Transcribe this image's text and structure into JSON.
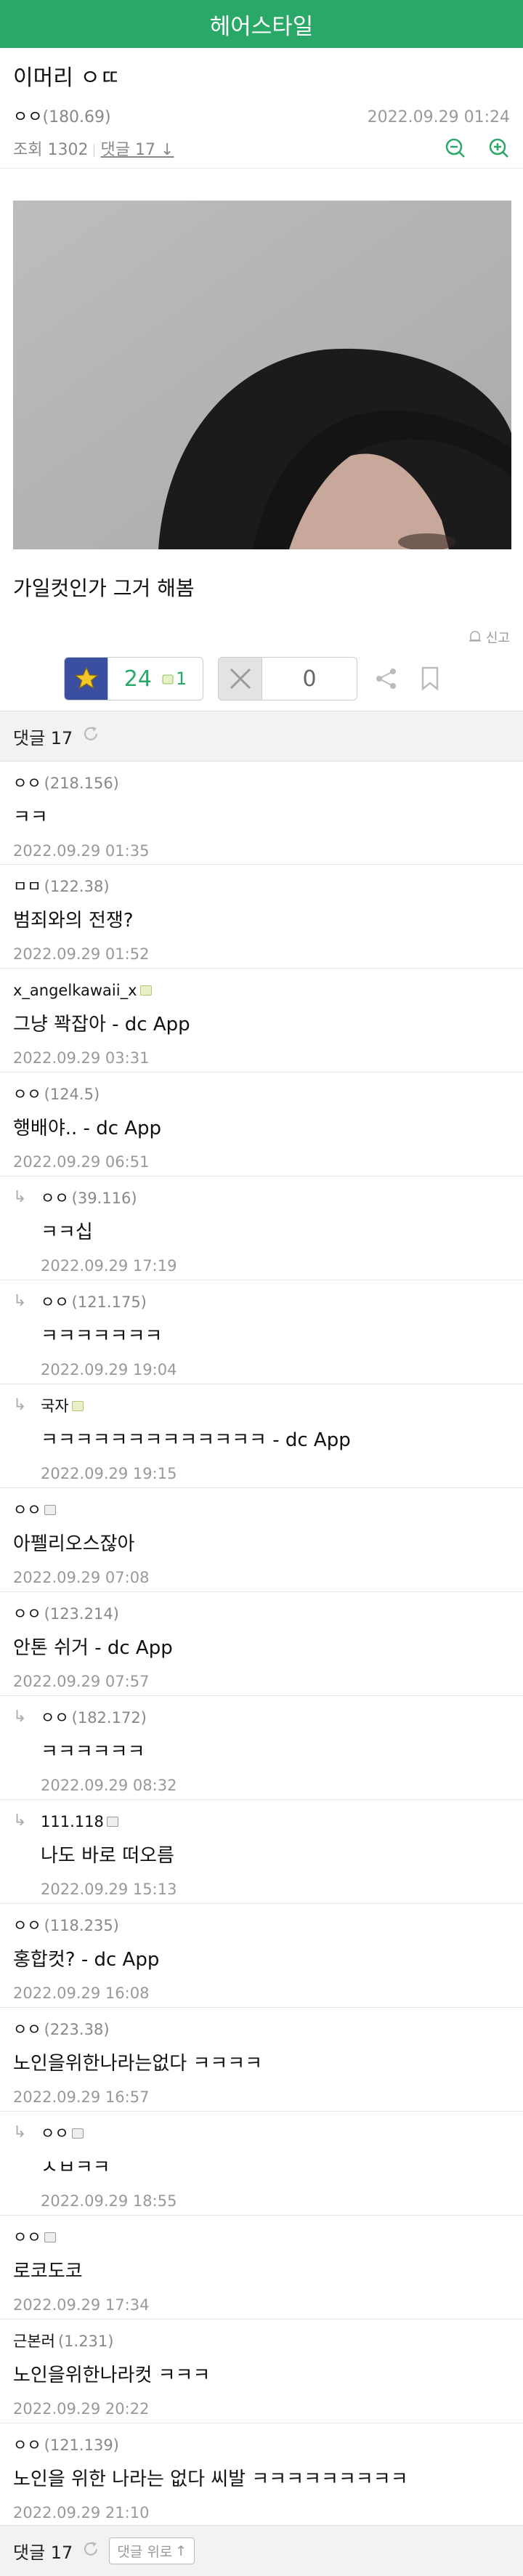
{
  "header": {
    "title": "헤어스타일"
  },
  "post": {
    "title": "이머리 ㅇㄸ",
    "writer": "ㅇㅇ",
    "writer_ip": "(180.69)",
    "date": "2022.09.29 01:24",
    "views_label": "조회 1302",
    "comments_label": "댓글 17",
    "text": "가일컷인가 그거 해봄",
    "report_label": "신고",
    "recommend_count": "24",
    "fixed_recommend_count": "1",
    "unrecommend_count": "0"
  },
  "comment_bar": {
    "label": "댓글 17"
  },
  "comments": [
    {
      "writer": "ㅇㅇ",
      "ip": "(218.156)",
      "text": "ㅋㅋ",
      "date": "2022.09.29 01:35"
    },
    {
      "writer": "ㅁㅁ",
      "ip": "(122.38)",
      "text": "범죄와의 전쟁?",
      "date": "2022.09.29 01:52"
    },
    {
      "writer": "x_angelkawaii_x",
      "ip": "",
      "text": "그냥 꽉잡아 - dc App",
      "date": "2022.09.29 03:31"
    },
    {
      "writer": "ㅇㅇ",
      "ip": "(124.5)",
      "text": "행배야.. - dc App",
      "date": "2022.09.29 06:51"
    },
    {
      "writer": "ㅇㅇ",
      "ip": "(39.116)",
      "text": "ㅋㅋ십",
      "date": "2022.09.29 17:19"
    },
    {
      "writer": "ㅇㅇ",
      "ip": "(121.175)",
      "text": "ㅋㅋㅋㅋㅋㅋㅋ",
      "date": "2022.09.29 19:04"
    },
    {
      "writer": "국자",
      "ip": "",
      "text": "ㅋㅋㅋㅋㅋㅋㅋㅋㅋㅋㅋㅋㅋ - dc App",
      "date": "2022.09.29 19:15"
    },
    {
      "writer": "ㅇㅇ",
      "ip": "",
      "text": "아펠리오스잖아",
      "date": "2022.09.29 07:08"
    },
    {
      "writer": "ㅇㅇ",
      "ip": "(123.214)",
      "text": "안톤 쉬거 - dc App",
      "date": "2022.09.29 07:57"
    },
    {
      "writer": "ㅇㅇ",
      "ip": "(182.172)",
      "text": "ㅋㅋㅋㅋㅋㅋ",
      "date": "2022.09.29 08:32"
    },
    {
      "writer": "111.118",
      "ip": "",
      "text": "나도 바로 떠오름",
      "date": "2022.09.29 15:13"
    },
    {
      "writer": "ㅇㅇ",
      "ip": "(118.235)",
      "text": "홍합컷? - dc App",
      "date": "2022.09.29 16:08"
    },
    {
      "writer": "ㅇㅇ",
      "ip": "(223.38)",
      "text": "노인을위한나라는없다 ㅋㅋㅋㅋ",
      "date": "2022.09.29 16:57"
    },
    {
      "writer": "ㅇㅇ",
      "ip": "",
      "text": "ㅅㅂㅋㅋ",
      "date": "2022.09.29 18:55"
    },
    {
      "writer": "ㅇㅇ",
      "ip": "",
      "text": "로코도코",
      "date": "2022.09.29 17:34"
    },
    {
      "writer": "근본러",
      "ip": "(1.231)",
      "text": "노인을위한나라컷 ㅋㅋㅋ",
      "date": "2022.09.29 20:22"
    },
    {
      "writer": "ㅇㅇ",
      "ip": "(121.139)",
      "text": "노인을 위한 나라는 없다 씨발 ㅋㅋㅋㅋㅋㅋㅋㅋㅋ",
      "date": "2022.09.29 21:10"
    }
  ],
  "footer": {
    "comments_label": "댓글 17",
    "top_button": "댓글 위로"
  },
  "colors": {
    "accent": "#29a867"
  }
}
